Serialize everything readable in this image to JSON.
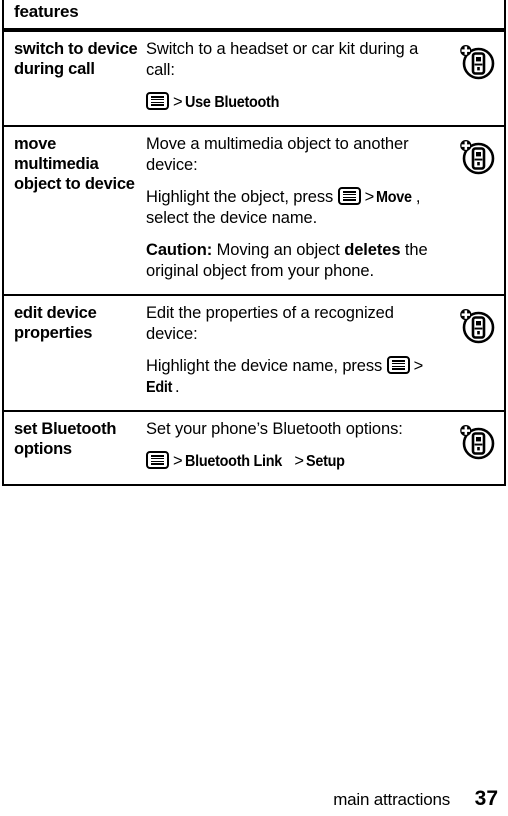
{
  "table": {
    "header": "features",
    "rows": [
      {
        "term": "switch to device during call",
        "icon": "bluetooth-device-add-icon",
        "paragraphs": [
          {
            "parts": [
              {
                "t": "text",
                "v": "Switch to a headset or car kit during a call:"
              }
            ]
          },
          {
            "parts": [
              {
                "t": "menukey",
                "v": "menu-key-icon"
              },
              {
                "t": "gt",
                "v": ">"
              },
              {
                "t": "menuword",
                "v": "Use Bluetooth"
              }
            ]
          }
        ]
      },
      {
        "term": "move multimedia object to device",
        "icon": "bluetooth-device-add-icon",
        "paragraphs": [
          {
            "parts": [
              {
                "t": "text",
                "v": "Move a multimedia object to another device:"
              }
            ]
          },
          {
            "parts": [
              {
                "t": "text",
                "v": "Highlight the object, press "
              },
              {
                "t": "menukey",
                "v": "menu-key-icon"
              },
              {
                "t": "gt",
                "v": ">"
              },
              {
                "t": "menuword",
                "v": "Move"
              },
              {
                "t": "text",
                "v": ", select the device name."
              }
            ]
          },
          {
            "parts": [
              {
                "t": "bold",
                "v": "Caution:"
              },
              {
                "t": "text",
                "v": " Moving an object "
              },
              {
                "t": "bold",
                "v": "deletes"
              },
              {
                "t": "text",
                "v": " the original object from your phone."
              }
            ]
          }
        ]
      },
      {
        "term": "edit device properties",
        "icon": "bluetooth-device-add-icon",
        "paragraphs": [
          {
            "parts": [
              {
                "t": "text",
                "v": "Edit the properties of a recognized device:"
              }
            ]
          },
          {
            "parts": [
              {
                "t": "text",
                "v": "Highlight the device name, press "
              },
              {
                "t": "menukey",
                "v": "menu-key-icon"
              },
              {
                "t": "gt",
                "v": ">"
              },
              {
                "t": "menuword",
                "v": "Edit"
              },
              {
                "t": "text",
                "v": "."
              }
            ]
          }
        ]
      },
      {
        "term": "set Bluetooth options",
        "icon": "bluetooth-device-add-icon",
        "paragraphs": [
          {
            "parts": [
              {
                "t": "text",
                "v": "Set your phone’s Bluetooth options:"
              }
            ]
          },
          {
            "parts": [
              {
                "t": "menukey",
                "v": "menu-key-icon"
              },
              {
                "t": "gt",
                "v": ">"
              },
              {
                "t": "menuword",
                "v": "Bluetooth Link"
              },
              {
                "t": "gt",
                "v": ">"
              },
              {
                "t": "menuword",
                "v": "Setup"
              }
            ]
          }
        ]
      }
    ]
  },
  "footer": {
    "section": "main attractions",
    "page_number": "37"
  },
  "colors": {
    "ink": "#000000",
    "paper": "#ffffff"
  }
}
